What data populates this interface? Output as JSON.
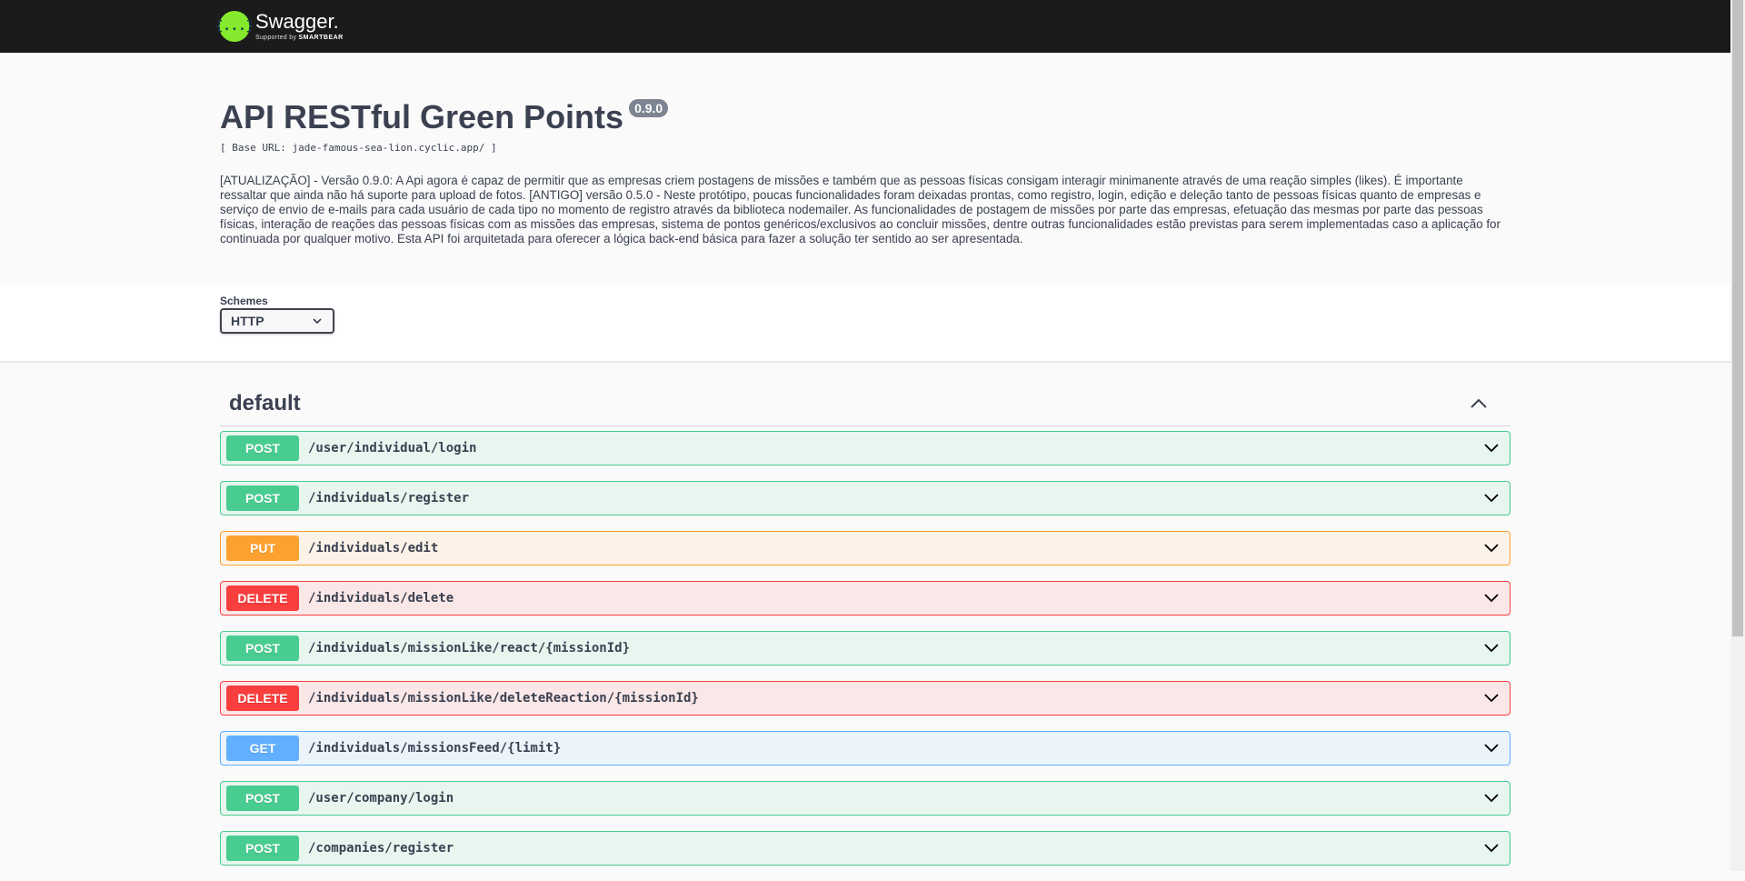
{
  "topbar": {
    "logo_mark": "{...}",
    "logo_name": "Swagger.",
    "logo_supported": "Supported by",
    "logo_brand": "SMARTBEAR"
  },
  "info": {
    "title": "API RESTful Green Points",
    "version": "0.9.0",
    "base_url": "[ Base URL: jade-famous-sea-lion.cyclic.app/ ]",
    "description": "[ATUALIZAÇÃO] - Versão 0.9.0: A Api agora é capaz de permitir que as empresas criem postagens de missões e também que as pessoas físicas consigam interagir minimanente através de uma reação simples (likes). É importante ressaltar que ainda não há suporte para upload de fotos. [ANTIGO] versão 0.5.0 - Neste protótipo, poucas funcionalidades foram deixadas prontas, como registro, login, edição e deleção tanto de pessoas físicas quanto de empresas e serviço de envio de e-mails para cada usuário de cada tipo no momento de registro através da biblioteca nodemailer. As funcionalidades de postagem de missões por parte das empresas, efetuação das mesmas por parte das pessoas físicas, interação de reações das pessoas físicas com as missões das empresas, sistema de pontos genéricos/exclusivos ao concluir missões, dentre outras funcionalidades estão previstas para serem implementadas caso a aplicação for continuada por qualquer motivo. Esta API foi arquitetada para oferecer a lógica back-end básica para fazer a solução ter sentido ao ser apresentada."
  },
  "schemes": {
    "label": "Schemes",
    "selected": "HTTP"
  },
  "section": {
    "title": "default"
  },
  "operations": [
    {
      "method": "POST",
      "path": "/user/individual/login"
    },
    {
      "method": "POST",
      "path": "/individuals/register"
    },
    {
      "method": "PUT",
      "path": "/individuals/edit"
    },
    {
      "method": "DELETE",
      "path": "/individuals/delete"
    },
    {
      "method": "POST",
      "path": "/individuals/missionLike/react/{missionId}"
    },
    {
      "method": "DELETE",
      "path": "/individuals/missionLike/deleteReaction/{missionId}"
    },
    {
      "method": "GET",
      "path": "/individuals/missionsFeed/{limit}"
    },
    {
      "method": "POST",
      "path": "/user/company/login"
    },
    {
      "method": "POST",
      "path": "/companies/register"
    }
  ],
  "colors": {
    "post": "#49cc90",
    "put": "#fca130",
    "delete": "#f93e3e",
    "get": "#61affe",
    "topbar": "#1b1b1b",
    "logo": "#85ea2d"
  }
}
